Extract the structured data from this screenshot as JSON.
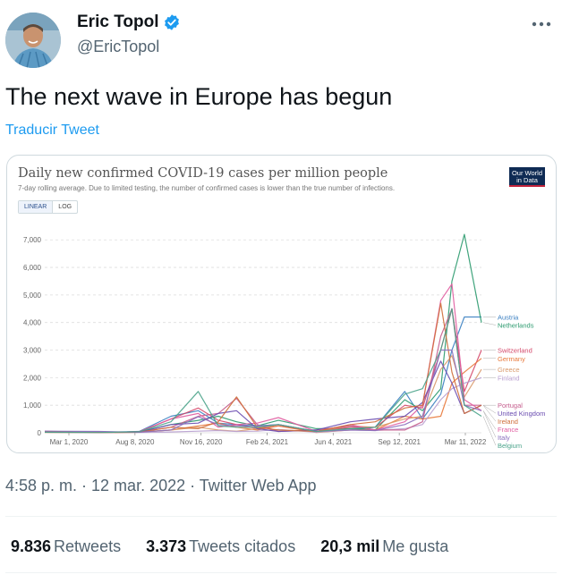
{
  "tweet": {
    "author_name": "Eric Topol",
    "handle": "@EricTopol",
    "text": "The next wave in Europe has begun",
    "translate_label": "Traducir Tweet",
    "meta": "4:58 p. m. · 12 mar. 2022 · Twitter Web App"
  },
  "stats": [
    {
      "value": "9.836",
      "label": "Retweets"
    },
    {
      "value": "3.373",
      "label": "Tweets citados"
    },
    {
      "value": "20,3 mil",
      "label": "Me gusta"
    }
  ],
  "icons": {
    "verified": "verified-badge-icon",
    "more": "more-icon",
    "logo": "our-world-in-data-logo"
  },
  "colors": {
    "link": "#1d9bf0",
    "verified": "#1d9bf0",
    "text_secondary": "#536471"
  },
  "chart_data": {
    "type": "line",
    "title": "Daily new confirmed COVID-19 cases per million people",
    "subtitle": "7-day rolling average. Due to limited testing, the number of confirmed cases is lower than the true number of infections.",
    "logo_text": "Our World in Data",
    "scale_options": [
      "LINEAR",
      "LOG"
    ],
    "selected_scale": "LINEAR",
    "x_ticks": [
      "Mar 1, 2020",
      "Aug 8, 2020",
      "Nov 16, 2020",
      "Feb 24, 2021",
      "Jun 4, 2021",
      "Sep 12, 2021",
      "Mar 11, 2022"
    ],
    "x": [
      "2020-03-01",
      "2020-06-01",
      "2020-08-08",
      "2020-10-01",
      "2020-11-16",
      "2020-12-20",
      "2021-01-20",
      "2021-02-24",
      "2021-04-01",
      "2021-06-04",
      "2021-08-01",
      "2021-09-12",
      "2021-11-01",
      "2021-12-01",
      "2022-01-01",
      "2022-01-20",
      "2022-02-10",
      "2022-03-11"
    ],
    "y_ticks": [
      0,
      1000,
      2000,
      3000,
      4000,
      5000,
      6000,
      7000
    ],
    "ylim": [
      0,
      7300
    ],
    "grid": true,
    "legend_position": "right",
    "series": [
      {
        "name": "Austria",
        "color": "#3a7fc1",
        "values": [
          40,
          10,
          50,
          600,
          800,
          350,
          300,
          250,
          300,
          50,
          100,
          200,
          1500,
          500,
          1400,
          3000,
          4200,
          4200
        ]
      },
      {
        "name": "Netherlands",
        "color": "#2b9a6e",
        "values": [
          30,
          10,
          40,
          300,
          450,
          600,
          400,
          250,
          450,
          150,
          150,
          100,
          1200,
          800,
          1600,
          5500,
          7200,
          4000
        ]
      },
      {
        "name": "Switzerland",
        "color": "#d4486a",
        "values": [
          60,
          10,
          40,
          500,
          900,
          450,
          300,
          150,
          250,
          50,
          200,
          200,
          1000,
          900,
          3000,
          4500,
          1500,
          3000
        ]
      },
      {
        "name": "Germany",
        "color": "#e8793b",
        "values": [
          20,
          10,
          20,
          100,
          250,
          350,
          200,
          100,
          250,
          10,
          100,
          100,
          600,
          500,
          600,
          1800,
          2200,
          2700
        ]
      },
      {
        "name": "Greece",
        "color": "#d99a6c",
        "values": [
          10,
          5,
          20,
          100,
          200,
          100,
          60,
          150,
          300,
          50,
          250,
          200,
          500,
          600,
          2300,
          2800,
          1300,
          2300
        ]
      },
      {
        "name": "Finland",
        "color": "#b89ecf",
        "values": [
          20,
          5,
          10,
          30,
          60,
          80,
          50,
          60,
          120,
          20,
          100,
          80,
          150,
          300,
          1200,
          1600,
          1800,
          2000
        ]
      },
      {
        "name": "Portugal",
        "color": "#c55d8d",
        "values": [
          20,
          30,
          30,
          200,
          600,
          700,
          1250,
          300,
          50,
          100,
          250,
          100,
          100,
          400,
          3500,
          4500,
          1000,
          1000
        ]
      },
      {
        "name": "France",
        "color": "#e05ca0",
        "values": [
          50,
          10,
          40,
          500,
          700,
          200,
          300,
          350,
          550,
          50,
          300,
          100,
          400,
          1000,
          4800,
          5400,
          1200,
          800
        ]
      },
      {
        "name": "United Kingdom",
        "color": "#6a4cb0",
        "values": [
          30,
          30,
          20,
          300,
          350,
          700,
          800,
          150,
          50,
          100,
          400,
          500,
          600,
          1100,
          2600,
          1800,
          700,
          1000
        ]
      },
      {
        "name": "Ireland",
        "color": "#cf6e3a",
        "values": [
          40,
          10,
          20,
          200,
          150,
          400,
          1300,
          200,
          100,
          50,
          300,
          400,
          900,
          1000,
          4700,
          2200,
          700,
          1000
        ]
      },
      {
        "name": "Italy",
        "color": "#8a6fbe",
        "values": [
          60,
          50,
          20,
          100,
          580,
          300,
          250,
          250,
          300,
          50,
          100,
          80,
          300,
          600,
          3000,
          3000,
          1000,
          800
        ]
      },
      {
        "name": "Belgium",
        "color": "#4aa38a",
        "values": [
          20,
          10,
          40,
          400,
          1500,
          250,
          200,
          200,
          300,
          50,
          150,
          200,
          1400,
          1600,
          3000,
          4500,
          1000,
          600
        ]
      }
    ]
  }
}
